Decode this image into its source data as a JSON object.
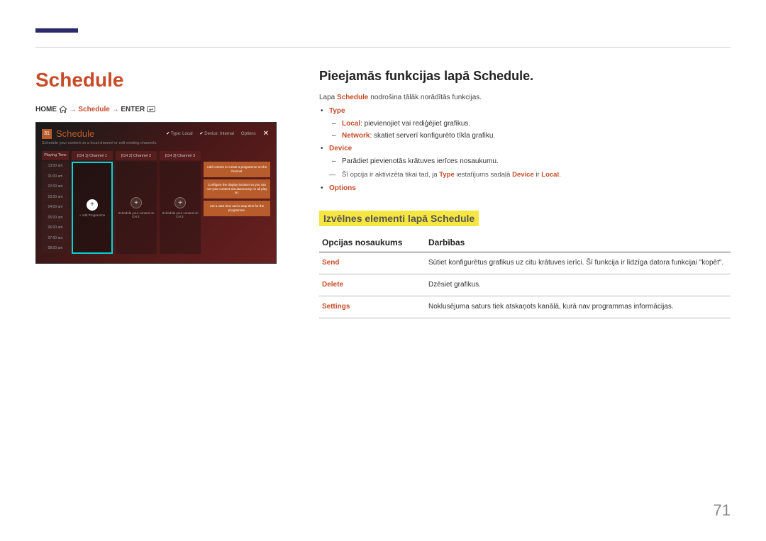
{
  "header": {
    "main_title": "Schedule",
    "breadcrumb_home": "HOME",
    "breadcrumb_arrow": " → ",
    "breadcrumb_schedule": "Schedule",
    "breadcrumb_enter": "ENTER"
  },
  "screenshot": {
    "cal_day": "31",
    "title": "Schedule",
    "subtitle": "Schedule your content on a local channel or edit existing channels.",
    "top": {
      "type_label": "Type: Local",
      "device_label": "Device: Internal",
      "options_label": "Options"
    },
    "times_head": "Playing Time",
    "times": [
      "13:00 am",
      "01:00 am",
      "02:00 am",
      "03:00 am",
      "04:00 am",
      "05:00 am",
      "06:00 am",
      "07:00 am",
      "08:00 am"
    ],
    "channels": [
      {
        "head": "[CH 1] Channel 1",
        "text": "+ Add Programme"
      },
      {
        "head": "[CH 2] Channel 2",
        "text": "Schedule your content on CH 2."
      },
      {
        "head": "[CH 3] Channel 3",
        "text": "Schedule your content on CH 3."
      }
    ],
    "side": [
      "Add content to create a programme on the channel.",
      "Configure the display location so you can run your content simultaneously on all play on.",
      "Set a start time and a stop time for the programme."
    ]
  },
  "right": {
    "title": "Pieejamās funkcijas lapā Schedule.",
    "intro_pre": "Lapa ",
    "intro_bold": "Schedule",
    "intro_post": " nodrošina tālāk norādītās funkcijas.",
    "items": {
      "type": {
        "label": "Type",
        "local_label": "Local",
        "local_text": ": pievienojiet vai rediģējiet grafikus.",
        "network_label": "Network",
        "network_text": ": skatiet serverī konfigurēto tīkla grafiku."
      },
      "device": {
        "label": "Device",
        "text": "Parādiet pievienotās krātuves ierīces nosaukumu.",
        "note_pre": "Šī opcija ir aktivizēta tikai tad, ja ",
        "note_type": "Type",
        "note_mid": " iestatījums sadaļā ",
        "note_device": "Device",
        "note_ir": " ir ",
        "note_local": "Local",
        "note_end": "."
      },
      "options": {
        "label": "Options"
      }
    },
    "subsection": "Izvēlnes elementi lapā Schedule",
    "table": {
      "col1": "Opcijas nosaukums",
      "col2": "Darbības",
      "rows": [
        {
          "name": "Send",
          "desc": "Sūtiet konfigurētus grafikus uz citu krātuves ierīci. Šī funkcija ir līdzīga datora funkcijai \"kopēt\"."
        },
        {
          "name": "Delete",
          "desc": "Dzēsiet grafikus."
        },
        {
          "name": "Settings",
          "desc": "Noklusējuma saturs tiek atskaņots kanālā, kurā nav programmas informācijas."
        }
      ]
    }
  },
  "page_num": "71"
}
